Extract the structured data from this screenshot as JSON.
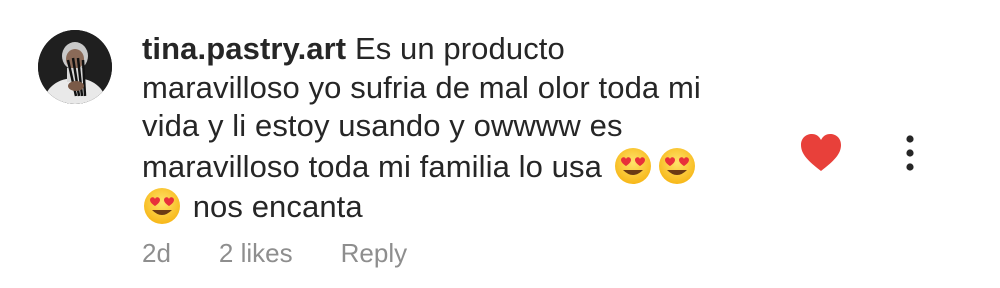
{
  "comment": {
    "username": "tina.pastry.art",
    "text_line_1": "Es un producto",
    "text_line_2": "maravilloso yo sufria de mal olor toda mi",
    "text_line_3": "vida y li estoy usando y owwww es",
    "text_line_4": "maravilloso toda mi familia lo usa",
    "text_line_5": "nos encanta",
    "emojis": [
      "heart-eyes-emoji",
      "heart-eyes-emoji",
      "heart-eyes-emoji"
    ],
    "liked": true
  },
  "meta": {
    "time": "2d",
    "likes": "2 likes",
    "reply_label": "Reply"
  },
  "icons": {
    "like": "heart-icon",
    "more": "more-options-icon"
  },
  "colors": {
    "text": "#262626",
    "secondary": "#8e8e8e",
    "heart": "#ED4956"
  }
}
